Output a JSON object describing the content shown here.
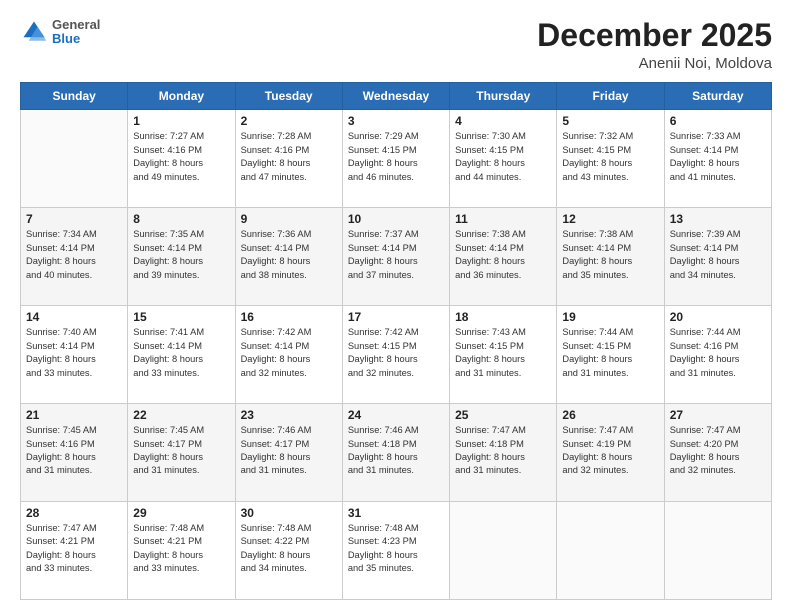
{
  "logo": {
    "general": "General",
    "blue": "Blue"
  },
  "header": {
    "month": "December 2025",
    "location": "Anenii Noi, Moldova"
  },
  "weekdays": [
    "Sunday",
    "Monday",
    "Tuesday",
    "Wednesday",
    "Thursday",
    "Friday",
    "Saturday"
  ],
  "weeks": [
    [
      {
        "day": "",
        "info": ""
      },
      {
        "day": "1",
        "info": "Sunrise: 7:27 AM\nSunset: 4:16 PM\nDaylight: 8 hours\nand 49 minutes."
      },
      {
        "day": "2",
        "info": "Sunrise: 7:28 AM\nSunset: 4:16 PM\nDaylight: 8 hours\nand 47 minutes."
      },
      {
        "day": "3",
        "info": "Sunrise: 7:29 AM\nSunset: 4:15 PM\nDaylight: 8 hours\nand 46 minutes."
      },
      {
        "day": "4",
        "info": "Sunrise: 7:30 AM\nSunset: 4:15 PM\nDaylight: 8 hours\nand 44 minutes."
      },
      {
        "day": "5",
        "info": "Sunrise: 7:32 AM\nSunset: 4:15 PM\nDaylight: 8 hours\nand 43 minutes."
      },
      {
        "day": "6",
        "info": "Sunrise: 7:33 AM\nSunset: 4:14 PM\nDaylight: 8 hours\nand 41 minutes."
      }
    ],
    [
      {
        "day": "7",
        "info": "Sunrise: 7:34 AM\nSunset: 4:14 PM\nDaylight: 8 hours\nand 40 minutes."
      },
      {
        "day": "8",
        "info": "Sunrise: 7:35 AM\nSunset: 4:14 PM\nDaylight: 8 hours\nand 39 minutes."
      },
      {
        "day": "9",
        "info": "Sunrise: 7:36 AM\nSunset: 4:14 PM\nDaylight: 8 hours\nand 38 minutes."
      },
      {
        "day": "10",
        "info": "Sunrise: 7:37 AM\nSunset: 4:14 PM\nDaylight: 8 hours\nand 37 minutes."
      },
      {
        "day": "11",
        "info": "Sunrise: 7:38 AM\nSunset: 4:14 PM\nDaylight: 8 hours\nand 36 minutes."
      },
      {
        "day": "12",
        "info": "Sunrise: 7:38 AM\nSunset: 4:14 PM\nDaylight: 8 hours\nand 35 minutes."
      },
      {
        "day": "13",
        "info": "Sunrise: 7:39 AM\nSunset: 4:14 PM\nDaylight: 8 hours\nand 34 minutes."
      }
    ],
    [
      {
        "day": "14",
        "info": "Sunrise: 7:40 AM\nSunset: 4:14 PM\nDaylight: 8 hours\nand 33 minutes."
      },
      {
        "day": "15",
        "info": "Sunrise: 7:41 AM\nSunset: 4:14 PM\nDaylight: 8 hours\nand 33 minutes."
      },
      {
        "day": "16",
        "info": "Sunrise: 7:42 AM\nSunset: 4:14 PM\nDaylight: 8 hours\nand 32 minutes."
      },
      {
        "day": "17",
        "info": "Sunrise: 7:42 AM\nSunset: 4:15 PM\nDaylight: 8 hours\nand 32 minutes."
      },
      {
        "day": "18",
        "info": "Sunrise: 7:43 AM\nSunset: 4:15 PM\nDaylight: 8 hours\nand 31 minutes."
      },
      {
        "day": "19",
        "info": "Sunrise: 7:44 AM\nSunset: 4:15 PM\nDaylight: 8 hours\nand 31 minutes."
      },
      {
        "day": "20",
        "info": "Sunrise: 7:44 AM\nSunset: 4:16 PM\nDaylight: 8 hours\nand 31 minutes."
      }
    ],
    [
      {
        "day": "21",
        "info": "Sunrise: 7:45 AM\nSunset: 4:16 PM\nDaylight: 8 hours\nand 31 minutes."
      },
      {
        "day": "22",
        "info": "Sunrise: 7:45 AM\nSunset: 4:17 PM\nDaylight: 8 hours\nand 31 minutes."
      },
      {
        "day": "23",
        "info": "Sunrise: 7:46 AM\nSunset: 4:17 PM\nDaylight: 8 hours\nand 31 minutes."
      },
      {
        "day": "24",
        "info": "Sunrise: 7:46 AM\nSunset: 4:18 PM\nDaylight: 8 hours\nand 31 minutes."
      },
      {
        "day": "25",
        "info": "Sunrise: 7:47 AM\nSunset: 4:18 PM\nDaylight: 8 hours\nand 31 minutes."
      },
      {
        "day": "26",
        "info": "Sunrise: 7:47 AM\nSunset: 4:19 PM\nDaylight: 8 hours\nand 32 minutes."
      },
      {
        "day": "27",
        "info": "Sunrise: 7:47 AM\nSunset: 4:20 PM\nDaylight: 8 hours\nand 32 minutes."
      }
    ],
    [
      {
        "day": "28",
        "info": "Sunrise: 7:47 AM\nSunset: 4:21 PM\nDaylight: 8 hours\nand 33 minutes."
      },
      {
        "day": "29",
        "info": "Sunrise: 7:48 AM\nSunset: 4:21 PM\nDaylight: 8 hours\nand 33 minutes."
      },
      {
        "day": "30",
        "info": "Sunrise: 7:48 AM\nSunset: 4:22 PM\nDaylight: 8 hours\nand 34 minutes."
      },
      {
        "day": "31",
        "info": "Sunrise: 7:48 AM\nSunset: 4:23 PM\nDaylight: 8 hours\nand 35 minutes."
      },
      {
        "day": "",
        "info": ""
      },
      {
        "day": "",
        "info": ""
      },
      {
        "day": "",
        "info": ""
      }
    ]
  ]
}
